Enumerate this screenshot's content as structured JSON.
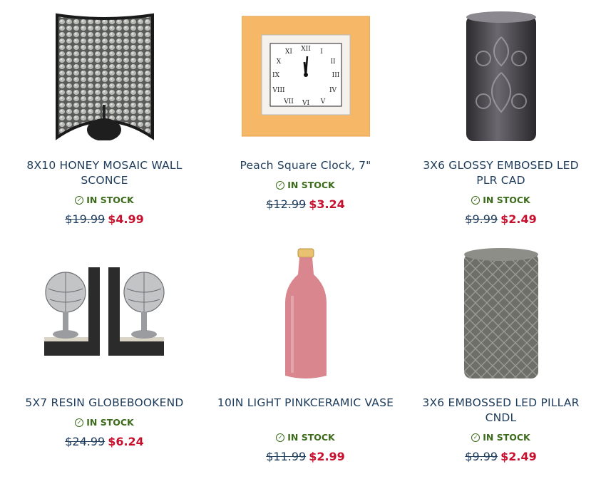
{
  "products": [
    {
      "title": "8X10 HONEY MOSAIC WALL SCONCE",
      "stock": "IN STOCK",
      "old_price": "$19.99",
      "new_price": "$4.99",
      "image": "mosaic-sconce-image"
    },
    {
      "title": "Peach Square Clock, 7\"",
      "stock": "IN STOCK",
      "old_price": "$12.99",
      "new_price": "$3.24",
      "image": "peach-clock-image"
    },
    {
      "title": "3X6 GLOSSY EMBOSED LED PLR CAD",
      "stock": "IN STOCK",
      "old_price": "$9.99",
      "new_price": "$2.49",
      "image": "embossed-candle-image"
    },
    {
      "title": "5X7 RESIN GLOBEBOOKEND",
      "stock": "IN STOCK",
      "old_price": "$24.99",
      "new_price": "$6.24",
      "image": "globe-bookend-image"
    },
    {
      "title": "10IN LIGHT PINKCERAMIC VASE",
      "stock": "IN STOCK",
      "old_price": "$11.99",
      "new_price": "$2.99",
      "image": "pink-vase-image"
    },
    {
      "title": "3X6 EMBOSSED LED PILLAR CNDL",
      "stock": "IN STOCK",
      "old_price": "$9.99",
      "new_price": "$2.49",
      "image": "gray-pillar-candle-image"
    }
  ],
  "colors": {
    "title": "#1d3b5a",
    "stock": "#3c6b1b",
    "sale": "#c8102e"
  }
}
